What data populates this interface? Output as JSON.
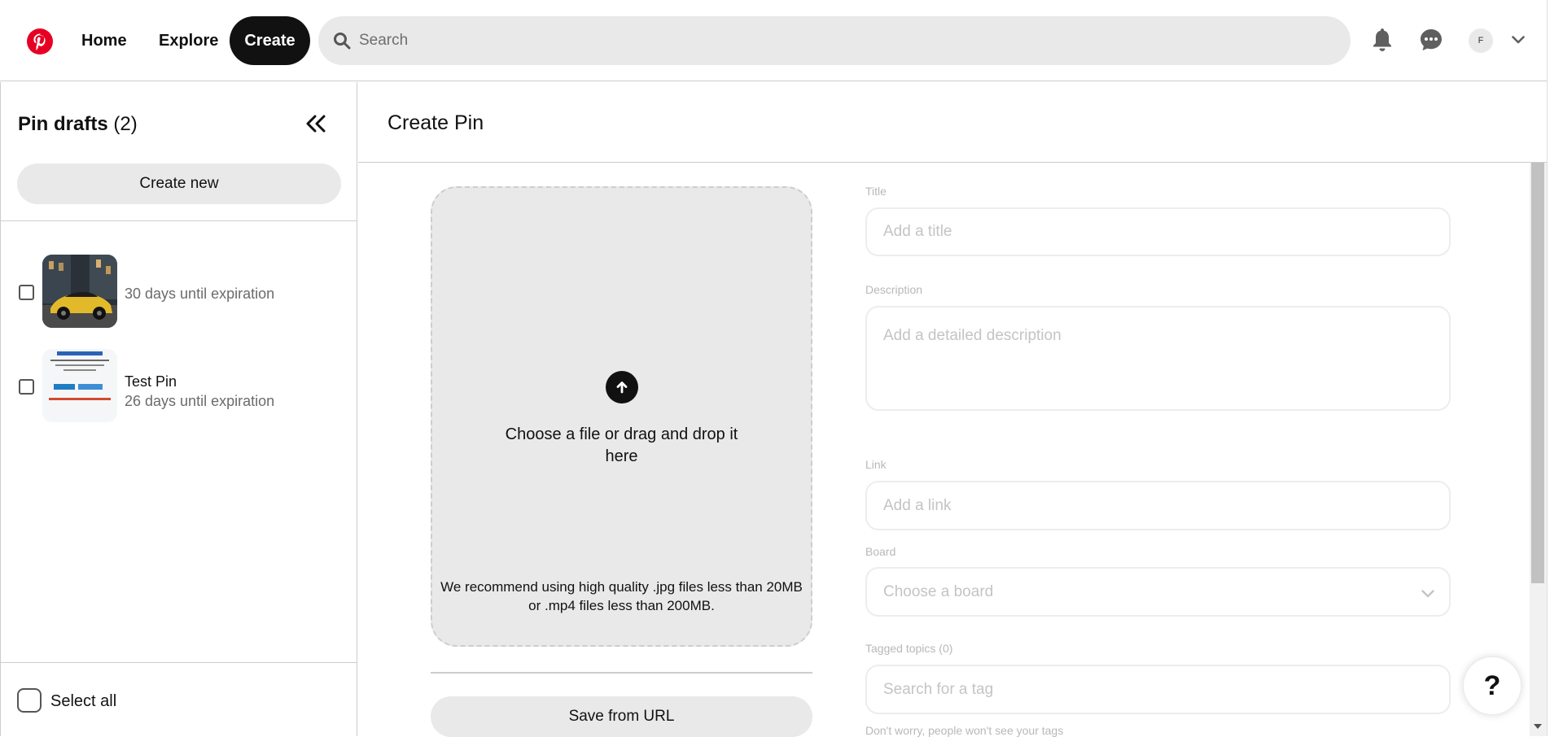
{
  "header": {
    "home": "Home",
    "explore": "Explore",
    "create": "Create",
    "search_placeholder": "Search",
    "avatar_initial": "F"
  },
  "sidebar": {
    "title": "Pin drafts",
    "count": "(2)",
    "create_new": "Create new",
    "drafts": [
      {
        "name": "",
        "expiration": "30 days until expiration"
      },
      {
        "name": "Test Pin",
        "expiration": "26 days until expiration"
      }
    ],
    "select_all": "Select all"
  },
  "main": {
    "title": "Create Pin",
    "upload": {
      "prompt": "Choose a file or drag and drop it here",
      "recommendation": "We recommend using high quality .jpg files less than 20MB or .mp4 files less than 200MB."
    },
    "save_from_url": "Save from URL",
    "fields": {
      "title_label": "Title",
      "title_placeholder": "Add a title",
      "description_label": "Description",
      "description_placeholder": "Add a detailed description",
      "link_label": "Link",
      "link_placeholder": "Add a link",
      "board_label": "Board",
      "board_placeholder": "Choose a board",
      "tags_label": "Tagged topics (0)",
      "tags_placeholder": "Search for a tag",
      "tags_hint": "Don't worry, people won't see your tags"
    }
  },
  "help": {
    "label": "?"
  },
  "colors": {
    "brand": "#e60023",
    "dark": "#111111",
    "muted": "#e9e9e9"
  }
}
